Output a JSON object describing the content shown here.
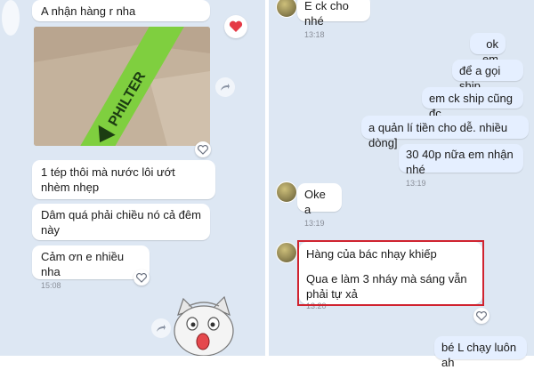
{
  "left_chat": {
    "messages": [
      {
        "text": "A nhận hàng r nha"
      },
      {
        "text": "1 tép thôi mà nước lôi ướt nhèm nhẹp"
      },
      {
        "text": "Dâm quá phải chiều nó cả đêm này"
      },
      {
        "text": "Cảm ơn e nhiều nha",
        "time": "15:08"
      }
    ],
    "photo": {
      "label": "PHILTER",
      "caption": "photo of a green PHILTER package"
    }
  },
  "right_chat": {
    "incoming_top": {
      "text": "E ck cho  nhé",
      "time": "13:18"
    },
    "outgoing": [
      {
        "text": "ok em"
      },
      {
        "text": "để a gọi ship"
      },
      {
        "text": "em ck ship cũng đc"
      },
      {
        "text": "a quản lí tiền cho dễ. nhiều dòng]"
      },
      {
        "text": "30 40p nữa em nhận nhé",
        "time": "13:19"
      }
    ],
    "incoming_oke": {
      "text": "Oke a",
      "time": "13:19"
    },
    "highlighted": {
      "line1": "Hàng của bác nhạy khiếp",
      "line2": "Qua e làm 3 nháy mà sáng vẫn phải tự xả",
      "time": "13:20"
    },
    "bottom_outgoing": {
      "text": "bé L chạy luôn ah"
    }
  },
  "colors": {
    "highlight": "#d0232f",
    "chat_bg": "#dde7f3",
    "outgoing_bubble": "#e5efff",
    "heart": "#e53945"
  },
  "icons": [
    "heart-icon",
    "share-icon",
    "like-icon",
    "avatar"
  ]
}
